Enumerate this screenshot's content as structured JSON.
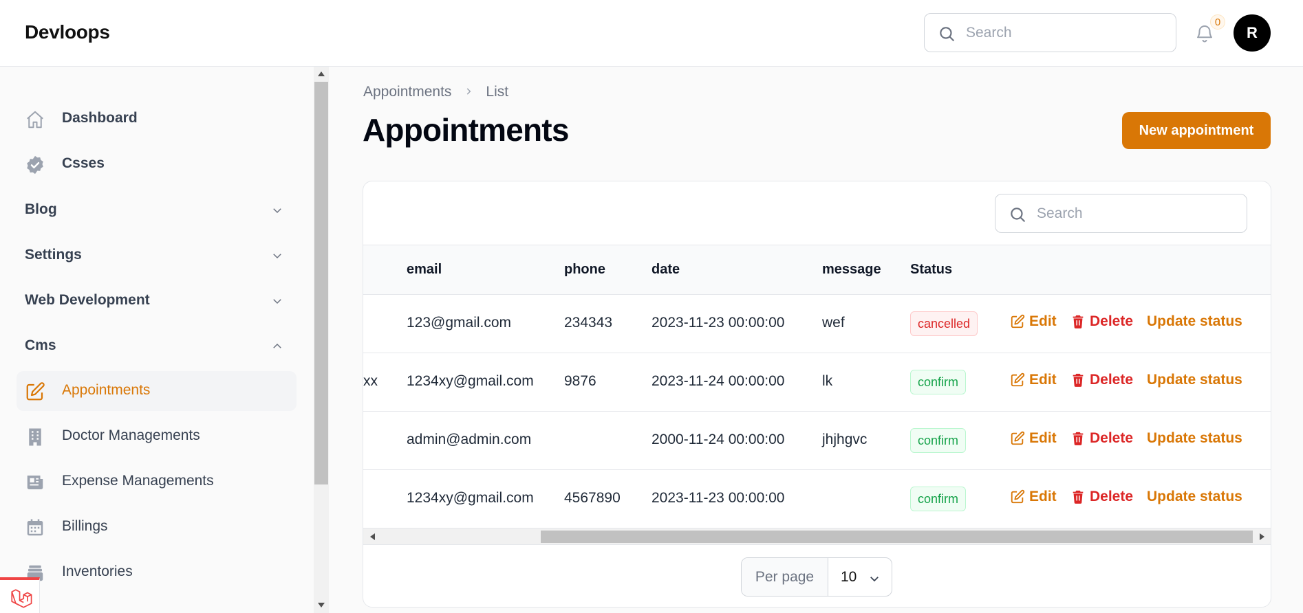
{
  "app": {
    "brand": "Devloops"
  },
  "topbar": {
    "search_placeholder": "Search",
    "notifications_count": "0",
    "avatar_initial": "R"
  },
  "sidebar": {
    "items_top": [
      {
        "label": "Dashboard",
        "icon": "home-icon"
      },
      {
        "label": "Csses",
        "icon": "badge-check-icon"
      }
    ],
    "groups": [
      {
        "label": "Blog",
        "state": "collapsed"
      },
      {
        "label": "Settings",
        "state": "collapsed"
      },
      {
        "label": "Web Development",
        "state": "collapsed"
      },
      {
        "label": "Cms",
        "state": "expanded"
      }
    ],
    "cms_items": [
      {
        "label": "Appointments",
        "icon": "pencil-square-icon",
        "active": true
      },
      {
        "label": "Doctor Managements",
        "icon": "building-icon"
      },
      {
        "label": "Expense Managements",
        "icon": "newspaper-icon"
      },
      {
        "label": "Billings",
        "icon": "calendar-icon"
      },
      {
        "label": "Inventories",
        "icon": "archive-icon"
      }
    ]
  },
  "breadcrumb": {
    "parent": "Appointments",
    "current": "List"
  },
  "page": {
    "title": "Appointments",
    "new_button": "New appointment"
  },
  "table": {
    "search_placeholder": "Search",
    "columns": [
      "email",
      "phone",
      "date",
      "message",
      "Status"
    ],
    "rows": [
      {
        "name_fragment": "",
        "email": "123@gmail.com",
        "phone": "234343",
        "date": "2023-11-23 00:00:00",
        "message": "wef",
        "status": "cancelled",
        "status_kind": "danger"
      },
      {
        "name_fragment": "xx",
        "email": "1234xy@gmail.com",
        "phone": "9876",
        "date": "2023-11-24 00:00:00",
        "message": "lk",
        "status": "confirm",
        "status_kind": "success"
      },
      {
        "name_fragment": "",
        "email": "admin@admin.com",
        "phone": "",
        "date": "2000-11-24 00:00:00",
        "message": "jhjhgvc",
        "status": "confirm",
        "status_kind": "success"
      },
      {
        "name_fragment": "",
        "email": "1234xy@gmail.com",
        "phone": "4567890",
        "date": "2023-11-23 00:00:00",
        "message": "",
        "status": "confirm",
        "status_kind": "success"
      }
    ],
    "actions": {
      "edit": "Edit",
      "delete": "Delete",
      "update_status": "Update status"
    },
    "per_page_label": "Per page",
    "per_page_value": "10"
  },
  "colors": {
    "accent": "#d97706",
    "danger": "#dc2626",
    "success": "#16a34a"
  }
}
